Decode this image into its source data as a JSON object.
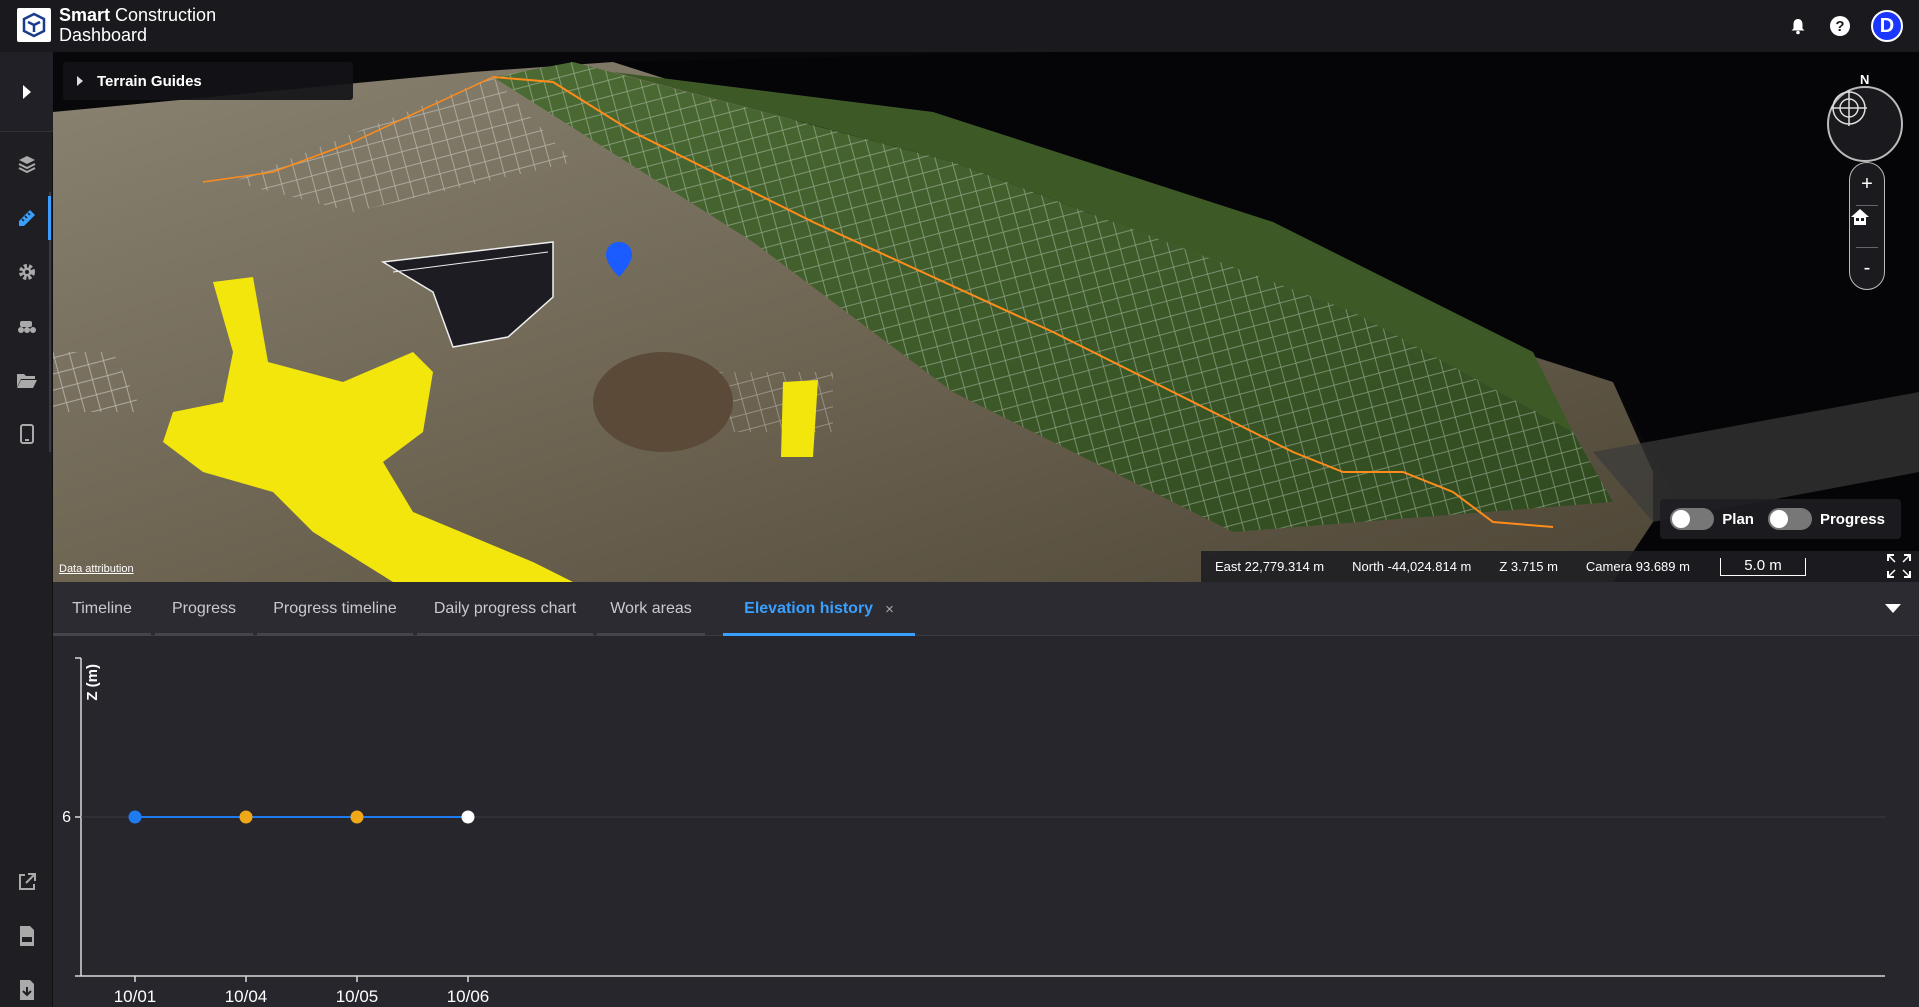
{
  "app": {
    "title_bold": "Smart",
    "title_rest": " Construction",
    "subtitle": "Dashboard",
    "avatar_initial": "D"
  },
  "map": {
    "terrain_guides_label": "Terrain Guides",
    "compass_label": "N",
    "zoom_in": "+",
    "zoom_out": "-",
    "toggles": [
      {
        "label": "Plan",
        "on": false
      },
      {
        "label": "Progress",
        "on": false
      }
    ],
    "attribution": "Data attribution",
    "coords": {
      "east": "East 22,779.314 m",
      "north": "North -44,024.814 m",
      "z": "Z 3.715 m",
      "camera": "Camera 93.689 m",
      "scale": "5.0 m"
    }
  },
  "tabs": [
    {
      "label": "Timeline"
    },
    {
      "label": "Progress"
    },
    {
      "label": "Progress timeline"
    },
    {
      "label": "Daily progress chart"
    },
    {
      "label": "Work areas"
    },
    {
      "label": "Elevation history",
      "active": true,
      "close": "×"
    }
  ],
  "chart_data": {
    "type": "line",
    "ylabel": "Z (m)",
    "y_tick_labels": [
      "6"
    ],
    "categories": [
      "10/01",
      "10/04",
      "10/05",
      "10/06"
    ],
    "series": [
      {
        "values": [
          6,
          6,
          6,
          6
        ],
        "point_colors": [
          "#1e7bf0",
          "#f0a818",
          "#f0a818",
          "#ffffff"
        ],
        "line_color": "#1e7bf0"
      }
    ],
    "grid": false
  },
  "colors": {
    "accent": "#3aa0ff",
    "cut_fill_yellow": "#f2e60c",
    "boundary_orange": "#ff8c1a",
    "marker_blue": "#1a5cff"
  }
}
